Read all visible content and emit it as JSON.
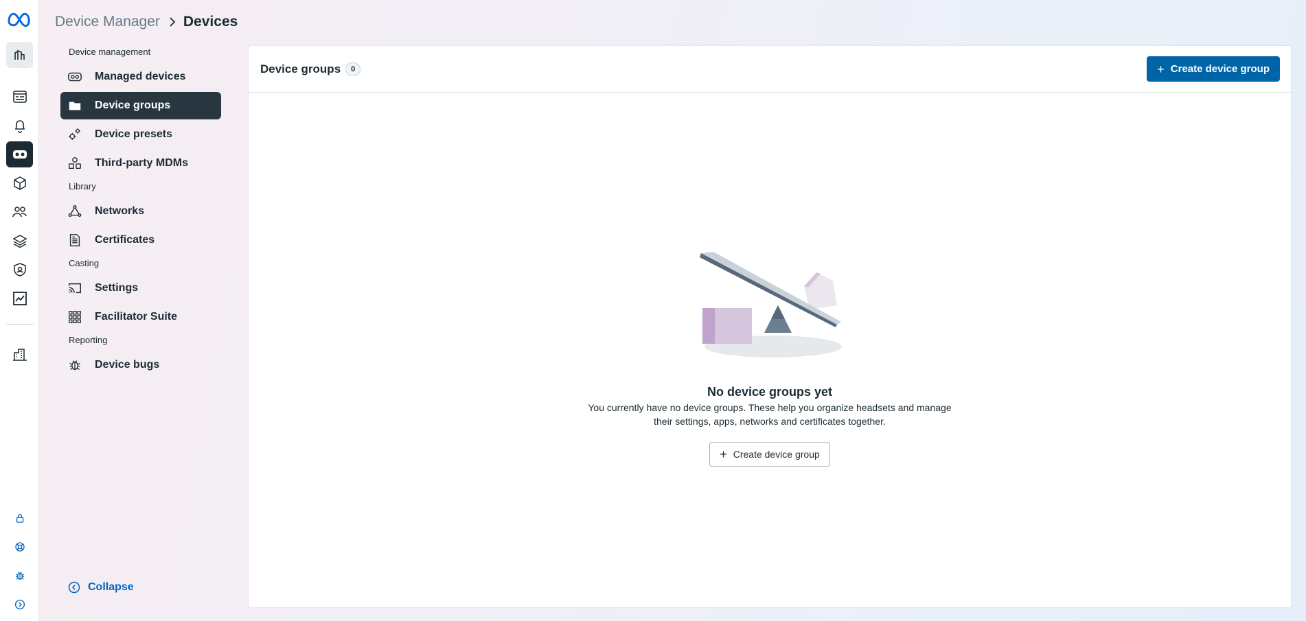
{
  "breadcrumb": {
    "parent": "Device Manager",
    "current": "Devices"
  },
  "rail": {
    "top_icons": [
      "meta-logo-icon",
      "buildings-icon",
      "browser-window-icon",
      "bell-icon",
      "vr-headset-icon",
      "cube-icon",
      "users-icon",
      "layers-icon",
      "shield-icon",
      "chart-icon",
      "office-building-icon"
    ],
    "bottom_icons": [
      "lock-icon",
      "lifebuoy-icon",
      "bug-icon",
      "expand-icon"
    ]
  },
  "nav": {
    "sections": [
      {
        "label": "Device management"
      },
      {
        "label": "Library"
      },
      {
        "label": "Casting"
      },
      {
        "label": "Reporting"
      }
    ],
    "items": {
      "managed_devices": "Managed devices",
      "device_groups": "Device groups",
      "device_presets": "Device presets",
      "third_party_mdms": "Third-party MDMs",
      "networks": "Networks",
      "certificates": "Certificates",
      "settings": "Settings",
      "facilitator_suite": "Facilitator Suite",
      "device_bugs": "Device bugs"
    },
    "collapse": "Collapse"
  },
  "panel": {
    "title": "Device groups",
    "count": "0",
    "create_button": "Create device group",
    "empty": {
      "heading": "No device groups yet",
      "description_line1": "You currently have no device groups. These help you organize headsets and manage",
      "description_line2": "their settings, apps, networks and certificates together.",
      "button": "Create device group"
    }
  },
  "colors": {
    "primary": "#0064a8",
    "active_nav": "#27363f",
    "link": "#0064c0",
    "text": "#1c2b33"
  }
}
